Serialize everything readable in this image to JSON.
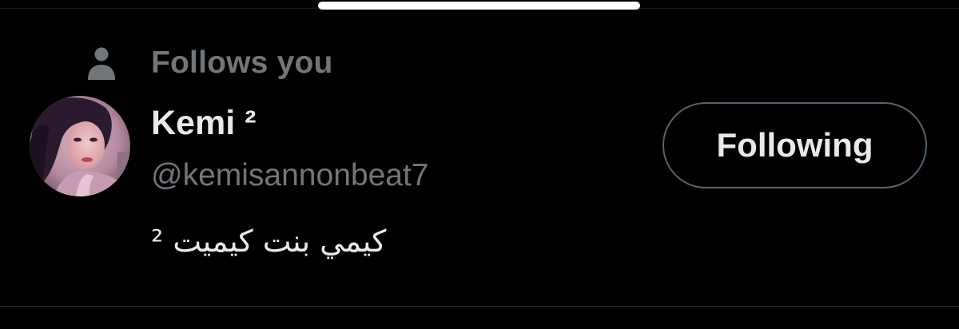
{
  "social_context": {
    "label": "Follows you",
    "icon": "person-icon"
  },
  "user": {
    "display_name": "Kemi ²",
    "handle": "@kemisannonbeat7",
    "bio": "كيمي بنت كيميت ²",
    "avatar": "avatar"
  },
  "actions": {
    "following_label": "Following"
  },
  "colors": {
    "background": "#000000",
    "primary_text": "#e7e9ea",
    "secondary_text": "#71767b",
    "button_border": "#536471",
    "divider": "#2f3336"
  }
}
